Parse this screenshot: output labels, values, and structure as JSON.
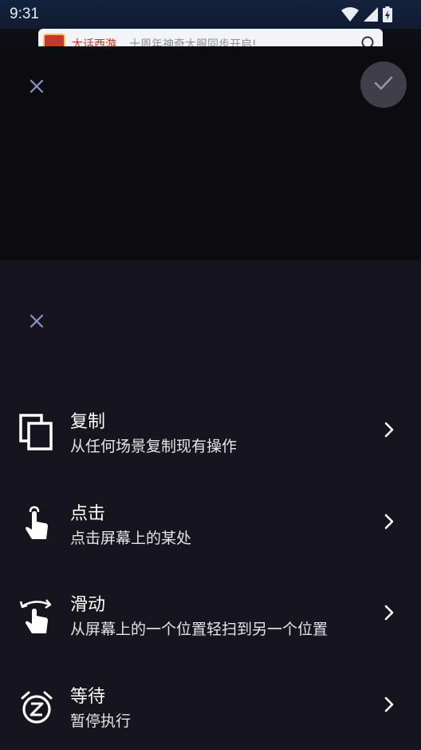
{
  "status_bar": {
    "time": "9:31"
  },
  "notification": {
    "app_name": "大话西游",
    "text": "十周年神奇大服同步开启!"
  },
  "sheet": {
    "actions": [
      {
        "title": "复制",
        "description": "从任何场景复制现有操作",
        "icon": "copy-icon"
      },
      {
        "title": "点击",
        "description": "点击屏幕上的某处",
        "icon": "tap-icon"
      },
      {
        "title": "滑动",
        "description": "从屏幕上的一个位置轻扫到另一个位置",
        "icon": "swipe-icon"
      },
      {
        "title": "等待",
        "description": "暂停执行",
        "icon": "alarm-snooze-icon"
      }
    ]
  },
  "colors": {
    "background": "#0f0e14",
    "top_panel": "#0c0b10",
    "sheet": "#16141c",
    "confirm_button": "#3f3e49",
    "close_icon": "#8e93c4",
    "text_primary": "#ffffff"
  }
}
